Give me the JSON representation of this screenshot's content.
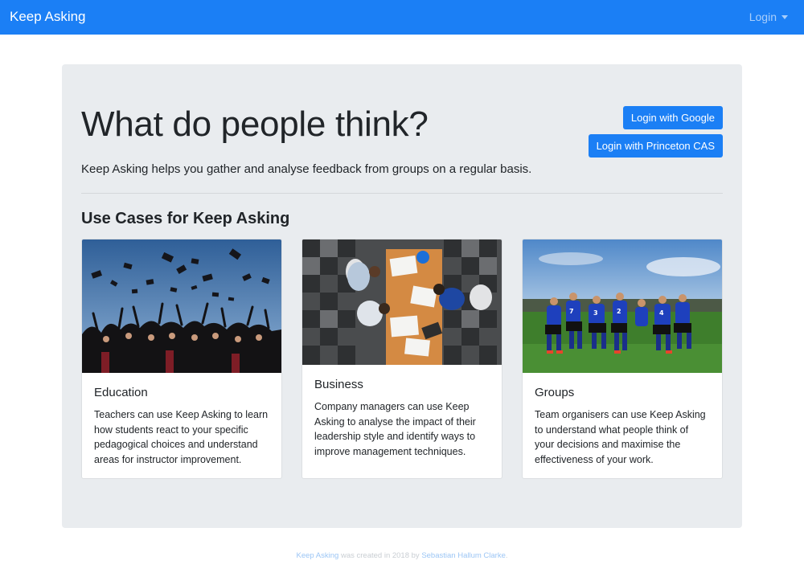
{
  "navbar": {
    "brand": "Keep Asking",
    "login_label": "Login"
  },
  "hero": {
    "headline": "What do people think?",
    "lead": "Keep Asking helps you gather and analyse feedback from groups on a regular basis.",
    "google_button": "Login with Google",
    "cas_button": "Login with Princeton CAS"
  },
  "section": {
    "title": "Use Cases for Keep Asking"
  },
  "cards": [
    {
      "title": "Education",
      "text": "Teachers can use Keep Asking to learn how students react to your specific pedagogical choices and understand areas for instructor improvement."
    },
    {
      "title": "Business",
      "text": "Company managers can use Keep Asking to analyse the impact of their leadership style and identify ways to improve management techniques."
    },
    {
      "title": "Groups",
      "text": "Team organisers can use Keep Asking to understand what people think of your decisions and maximise the effectiveness of your work."
    }
  ],
  "footer": {
    "app_link": "Keep Asking",
    "middle_text": " was created in 2018 by ",
    "author_link": "Sebastian Hallum Clarke",
    "end_text": "."
  },
  "colors": {
    "primary": "#1b7ff5",
    "jumbotron_bg": "#e9ecef"
  }
}
